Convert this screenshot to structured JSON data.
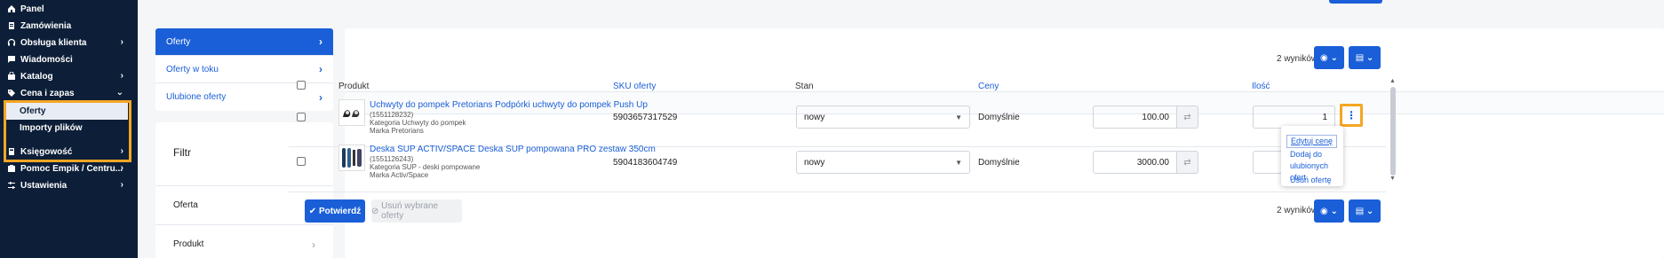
{
  "sidebar": {
    "items": [
      {
        "label": "Panel",
        "icon": "home-icon",
        "chevron": false
      },
      {
        "label": "Zamówienia",
        "icon": "orders-icon",
        "chevron": false
      },
      {
        "label": "Obsługa klienta",
        "icon": "headset-icon",
        "chevron": true
      },
      {
        "label": "Wiadomości",
        "icon": "message-icon",
        "chevron": false
      },
      {
        "label": "Katalog",
        "icon": "catalog-icon",
        "chevron": true
      },
      {
        "label": "Cena i zapas",
        "icon": "tag-icon",
        "chevron": true,
        "expanded": true
      },
      {
        "label": "Księgowość",
        "icon": "accounting-icon",
        "chevron": true
      },
      {
        "label": "Pomoc Empik / Centru...",
        "icon": "help-icon",
        "chevron": true
      },
      {
        "label": "Ustawienia",
        "icon": "settings-icon",
        "chevron": true
      }
    ],
    "subitems": [
      {
        "label": "Oferty",
        "active": true
      },
      {
        "label": "Importy plików",
        "active": false
      }
    ]
  },
  "tabs": [
    {
      "label": "Oferty",
      "active": true
    },
    {
      "label": "Oferty w toku",
      "active": false
    },
    {
      "label": "Ulubione oferty",
      "active": false
    }
  ],
  "filter": {
    "title": "Filtr",
    "rows": [
      "Oferta",
      "Produkt"
    ]
  },
  "results_label": "2 wyników",
  "table": {
    "headers": {
      "product": "Produkt",
      "sku": "SKU oferty",
      "state": "Stan",
      "prices": "Ceny",
      "quantity": "Ilość"
    },
    "rows": [
      {
        "name": "Uchwyty do pompek Pretorians Podpórki uchwyty do pompek Push Up",
        "id": "(1551128232)",
        "category": "Kategoria Uchwyty do pompek",
        "brand": "Marka Pretorians",
        "sku": "5903657317529",
        "state": "nowy",
        "price_label": "Domyślnie",
        "price": "100.00",
        "quantity": "1"
      },
      {
        "name": "Deska SUP ACTIV/SPACE Deska SUP pompowana PRO zestaw 350cm",
        "id": "(1551126243)",
        "category": "Kategoria SUP - deski pompowane",
        "brand": "Marka Activ/Space",
        "sku": "5904183604749",
        "state": "nowy",
        "price_label": "Domyślnie",
        "price": "3000.00",
        "quantity": ""
      }
    ]
  },
  "row_menu": [
    "Edytuj cenę",
    "Dodaj do ulubionych ofert",
    "Usuń ofertę"
  ],
  "footer": {
    "confirm_label": "Potwierdź",
    "remove_label": "Usuń wybrane oferty",
    "results_label": "2 wyników"
  },
  "colors": {
    "primary": "#1a5fd8",
    "sidebar": "#0d1f38",
    "highlight": "#f5a623"
  }
}
